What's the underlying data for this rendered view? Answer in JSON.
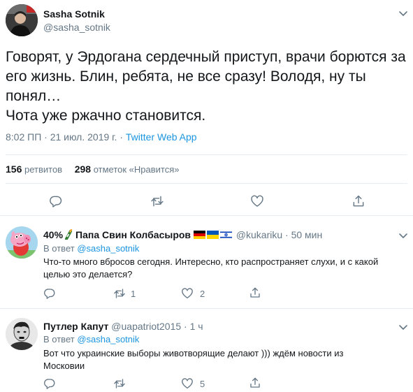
{
  "main_tweet": {
    "author_name": "Sasha Sotnik",
    "author_handle": "@sasha_sotnik",
    "text_lines": [
      "Говорят, у Эрдогана сердечный приступ, врачи борются за",
      "его жизнь. Блин, ребята, не все сразу! Володя, ну ты",
      "понял…",
      "Чота уже ржачно становится."
    ],
    "timestamp": "8:02 ПП · 21 июл. 2019 г. · ",
    "source": "Twitter Web App",
    "retweets_count": "156",
    "retweets_label": "ретвитов",
    "likes_count": "298",
    "likes_label": "отметок «Нравится»",
    "actions": [
      "reply-icon",
      "retweet-icon",
      "like-icon",
      "share-icon"
    ]
  },
  "replies": [
    {
      "name_prefix": "40%",
      "name": "Папа Свин Колбасыров",
      "flags": [
        "germany",
        "ukraine",
        "israel"
      ],
      "handle": "@kukariku",
      "time": "· 50 мин",
      "in_reply_label": "В ответ",
      "in_reply_mention": "@sasha_sotnik",
      "text_lines": [
        "Что-то много вбросов сегодня. Интересно, кто распространяет слухи, и с какой",
        "целью это делается?"
      ],
      "retweet_count": "1",
      "like_count": "2"
    },
    {
      "name": "Путлер Капут",
      "handle": "@uapatriot2015",
      "time": "· 1 ч",
      "in_reply_label": "В ответ",
      "in_reply_mention": "@sasha_sotnik",
      "text_lines": [
        "Вот что украинские выборы животворящие делают ))) ждём новости из",
        "Московии"
      ],
      "like_count": "5"
    }
  ],
  "colors": {
    "text": "#14171a",
    "secondary": "#657786",
    "link": "#1b95e0",
    "border": "#e6ecf0",
    "peppa_pink": "#f4a6c4",
    "sky_blue": "#a7d7ef"
  }
}
